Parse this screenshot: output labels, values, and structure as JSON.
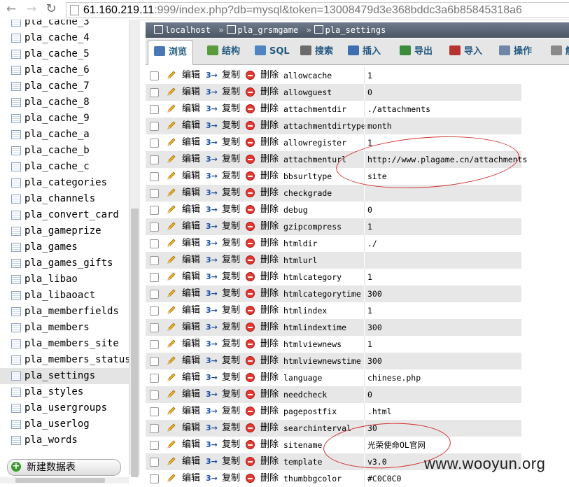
{
  "browser": {
    "url_host": "61.160.219.11",
    "url_rest": ":999/index.php?db=mysql&token=13008479d3e368bddc3a6b85845318a6"
  },
  "sidebar": {
    "tables": [
      {
        "label": "pla_cache_3"
      },
      {
        "label": "pla_cache_4"
      },
      {
        "label": "pla_cache_5"
      },
      {
        "label": "pla_cache_6"
      },
      {
        "label": "pla_cache_7"
      },
      {
        "label": "pla_cache_8"
      },
      {
        "label": "pla_cache_9"
      },
      {
        "label": "pla_cache_a"
      },
      {
        "label": "pla_cache_b"
      },
      {
        "label": "pla_cache_c"
      },
      {
        "label": "pla_categories"
      },
      {
        "label": "pla_channels"
      },
      {
        "label": "pla_convert_card"
      },
      {
        "label": "pla_gameprize"
      },
      {
        "label": "pla_games"
      },
      {
        "label": "pla_games_gifts"
      },
      {
        "label": "pla_libao"
      },
      {
        "label": "pla_libaoact"
      },
      {
        "label": "pla_memberfields"
      },
      {
        "label": "pla_members"
      },
      {
        "label": "pla_members_site"
      },
      {
        "label": "pla_members_status"
      },
      {
        "label": "pla_settings",
        "active": true
      },
      {
        "label": "pla_styles"
      },
      {
        "label": "pla_usergroups"
      },
      {
        "label": "pla_userlog"
      },
      {
        "label": "pla_words"
      }
    ],
    "new_table_label": "新建数据表"
  },
  "breadcrumb": {
    "server": "localhost",
    "database": "pla_grsmgame",
    "table": "pla_settings",
    "separator": "»"
  },
  "tabs": [
    {
      "label": "浏览",
      "icon": "browse-icon",
      "color": "#4a78b5",
      "active": true
    },
    {
      "label": "结构",
      "icon": "structure-icon",
      "color": "#5a9c3c"
    },
    {
      "label": "SQL",
      "icon": "sql-icon",
      "color": "#4f83c2"
    },
    {
      "label": "搜索",
      "icon": "search-icon",
      "color": "#6b6b6b"
    },
    {
      "label": "插入",
      "icon": "insert-icon",
      "color": "#3d6fb0"
    },
    {
      "label": "导出",
      "icon": "export-icon",
      "color": "#3b8c3b"
    },
    {
      "label": "导入",
      "icon": "import-icon",
      "color": "#b8332f"
    },
    {
      "label": "操作",
      "icon": "operations-icon",
      "color": "#6f86a6"
    },
    {
      "label": "触",
      "icon": "triggers-icon",
      "color": "#8a8a8a"
    }
  ],
  "row_actions": {
    "edit": "编辑",
    "copy": "复制",
    "delete": "删除"
  },
  "rows": [
    {
      "key": "allowcache",
      "value": "1"
    },
    {
      "key": "allowguest",
      "value": "0"
    },
    {
      "key": "attachmentdir",
      "value": "./attachments"
    },
    {
      "key": "attachmentdirtype",
      "value": "month"
    },
    {
      "key": "allowregister",
      "value": "1"
    },
    {
      "key": "attachmenturl",
      "value": "http://www.plagame.cn/attachments"
    },
    {
      "key": "bbsurltype",
      "value": "site"
    },
    {
      "key": "checkgrade",
      "value": ""
    },
    {
      "key": "debug",
      "value": "0"
    },
    {
      "key": "gzipcompress",
      "value": "1"
    },
    {
      "key": "htmldir",
      "value": "./"
    },
    {
      "key": "htmlurl",
      "value": ""
    },
    {
      "key": "htmlcategory",
      "value": "1"
    },
    {
      "key": "htmlcategorytime",
      "value": "300"
    },
    {
      "key": "htmlindex",
      "value": "1"
    },
    {
      "key": "htmlindextime",
      "value": "300"
    },
    {
      "key": "htmlviewnews",
      "value": "1"
    },
    {
      "key": "htmlviewnewstime",
      "value": "300"
    },
    {
      "key": "language",
      "value": "chinese.php"
    },
    {
      "key": "needcheck",
      "value": "0"
    },
    {
      "key": "pagepostfix",
      "value": ".html"
    },
    {
      "key": "searchinterval",
      "value": "30"
    },
    {
      "key": "sitename",
      "value": "光荣使命OL官网"
    },
    {
      "key": "template",
      "value": "v3.0"
    },
    {
      "key": "thumbbgcolor",
      "value": "#C0C0C0"
    }
  ],
  "watermark": "www.wooyun.org",
  "colors": {
    "annotation": "#d03030",
    "breadcrumb_bg": "#5a6574",
    "tab_text": "#235a81"
  }
}
